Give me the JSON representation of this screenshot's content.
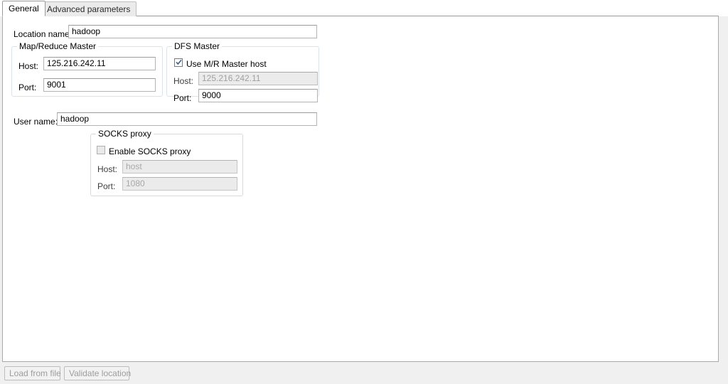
{
  "tabs": [
    {
      "label": "General",
      "active": true
    },
    {
      "label": "Advanced parameters",
      "active": false
    }
  ],
  "form": {
    "location_name": {
      "label": "Location name:",
      "value": "hadoop",
      "placeholder": ""
    },
    "user_name": {
      "label": "User name:",
      "value": "hadoop",
      "placeholder": ""
    }
  },
  "mapreduce_master": {
    "title": "Map/Reduce Master",
    "host": {
      "label": "Host:",
      "value": "125.216.242.11"
    },
    "port": {
      "label": "Port:",
      "value": "9001"
    }
  },
  "dfs_master": {
    "title": "DFS Master",
    "use_mr_host": {
      "label": "Use M/R Master host",
      "checked": true,
      "icon": "checkbox-checked-icon"
    },
    "host": {
      "label": "Host:",
      "value": "125.216.242.11",
      "disabled": true
    },
    "port": {
      "label": "Port:",
      "value": "9000",
      "disabled": false
    }
  },
  "socks_proxy": {
    "title": "SOCKS proxy",
    "enable": {
      "label": "Enable SOCKS proxy",
      "checked": false,
      "icon": "checkbox-unchecked-icon"
    },
    "host": {
      "label": "Host:",
      "value": "host",
      "disabled": true
    },
    "port": {
      "label": "Port:",
      "value": "1080",
      "disabled": true
    }
  },
  "footer": {
    "load_from_file": "Load from file",
    "validate_location": "Validate location"
  },
  "colors": {
    "panel_background": "#ffffff",
    "window_background": "#f0f0f0",
    "field_border": "#b4b4b4",
    "group_border": "#dde3ea",
    "disabled_text": "#a0a0a0",
    "checkmark": "#3b5b8c",
    "tab_inactive": "#ebebeb"
  }
}
